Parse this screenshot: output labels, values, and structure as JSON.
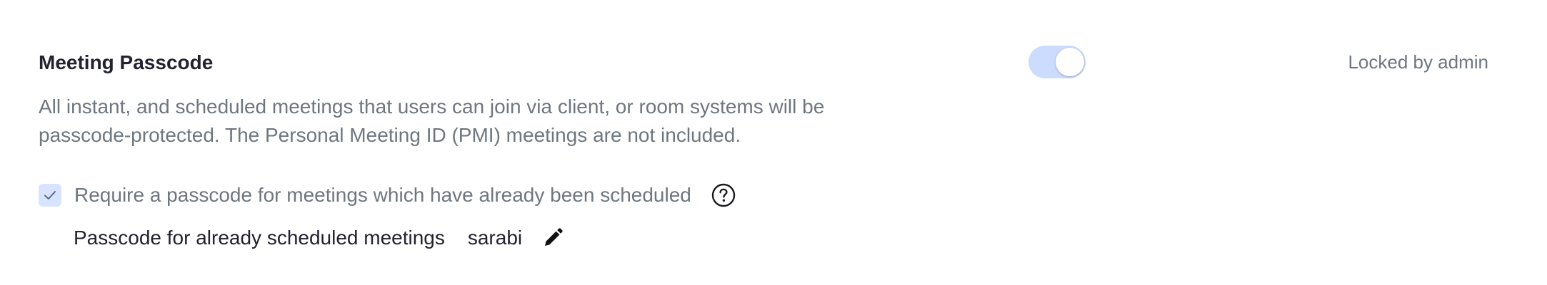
{
  "setting": {
    "title": "Meeting Passcode",
    "toggle": {
      "state": "on"
    },
    "locked_label": "Locked by admin",
    "description": [
      "All instant, and scheduled meetings that users can join via client, or room systems will be",
      "passcode-protected. The Personal Meeting ID (PMI) meetings are not included."
    ],
    "option": {
      "checked": true,
      "label": "Require a passcode for meetings which have already been scheduled",
      "help_icon": "question-circle-icon"
    },
    "passcode": {
      "label": "Passcode for already scheduled meetings",
      "value": "sarabi",
      "edit_icon": "pencil-icon"
    }
  },
  "colors": {
    "title": "#222230",
    "muted_text": "#6e7680",
    "toggle_track": "#ccdcff",
    "checkbox_bg": "#d8e4ff",
    "checkmark": "#5a6b86"
  }
}
